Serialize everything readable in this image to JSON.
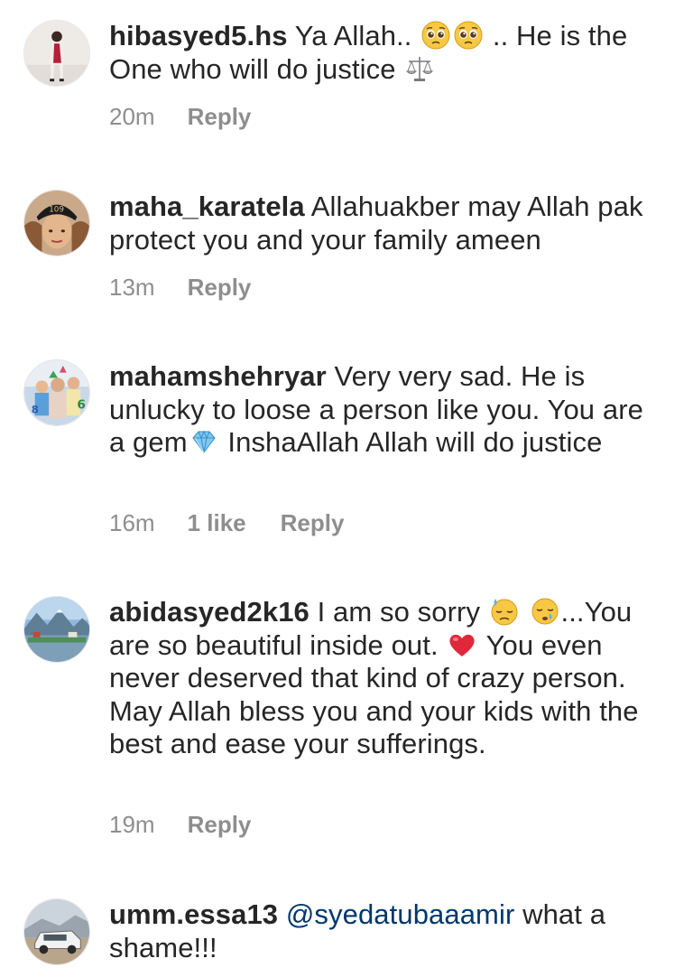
{
  "comments": [
    {
      "username": "hibasyed5.hs",
      "text_parts": [
        "Ya Allah..",
        ".. He is the One who will do justice"
      ],
      "emojis": [
        "pleading-face-emoji",
        "pleading-face-emoji",
        "scales-emoji"
      ],
      "time": "20m",
      "likes": "",
      "reply_label": "Reply"
    },
    {
      "username": "maha_karatela",
      "text_parts": [
        "Allahuakber may Allah pak protect you and your family ameen"
      ],
      "emojis": [],
      "time": "13m",
      "likes": "",
      "reply_label": "Reply"
    },
    {
      "username": "mahamshehryar",
      "text_parts": [
        "Very very sad. He is unlucky to loose a person like you. You are a gem",
        "InshaAllah Allah will do justice"
      ],
      "emojis": [
        "gem-stone-emoji"
      ],
      "time": "16m",
      "likes": "1 like",
      "reply_label": "Reply"
    },
    {
      "username": "abidasyed2k16",
      "text_parts": [
        "I am so sorry",
        "...You are so beautiful inside out.",
        "You even never deserved that kind of crazy person. May Allah bless you and your kids with the best and ease your sufferings."
      ],
      "emojis": [
        "downcast-sweat-face-emoji",
        "sleepy-face-emoji",
        "red-heart-emoji"
      ],
      "time": "19m",
      "likes": "",
      "reply_label": "Reply"
    },
    {
      "username": "umm.essa13",
      "mention": "@syedatubaaamir",
      "text_parts": [
        "what a shame!!!"
      ],
      "emojis": [],
      "time": "",
      "likes": "",
      "reply_label": ""
    }
  ],
  "colors": {
    "text": "#262626",
    "meta": "#8e8e8e",
    "mention": "#00376b"
  }
}
